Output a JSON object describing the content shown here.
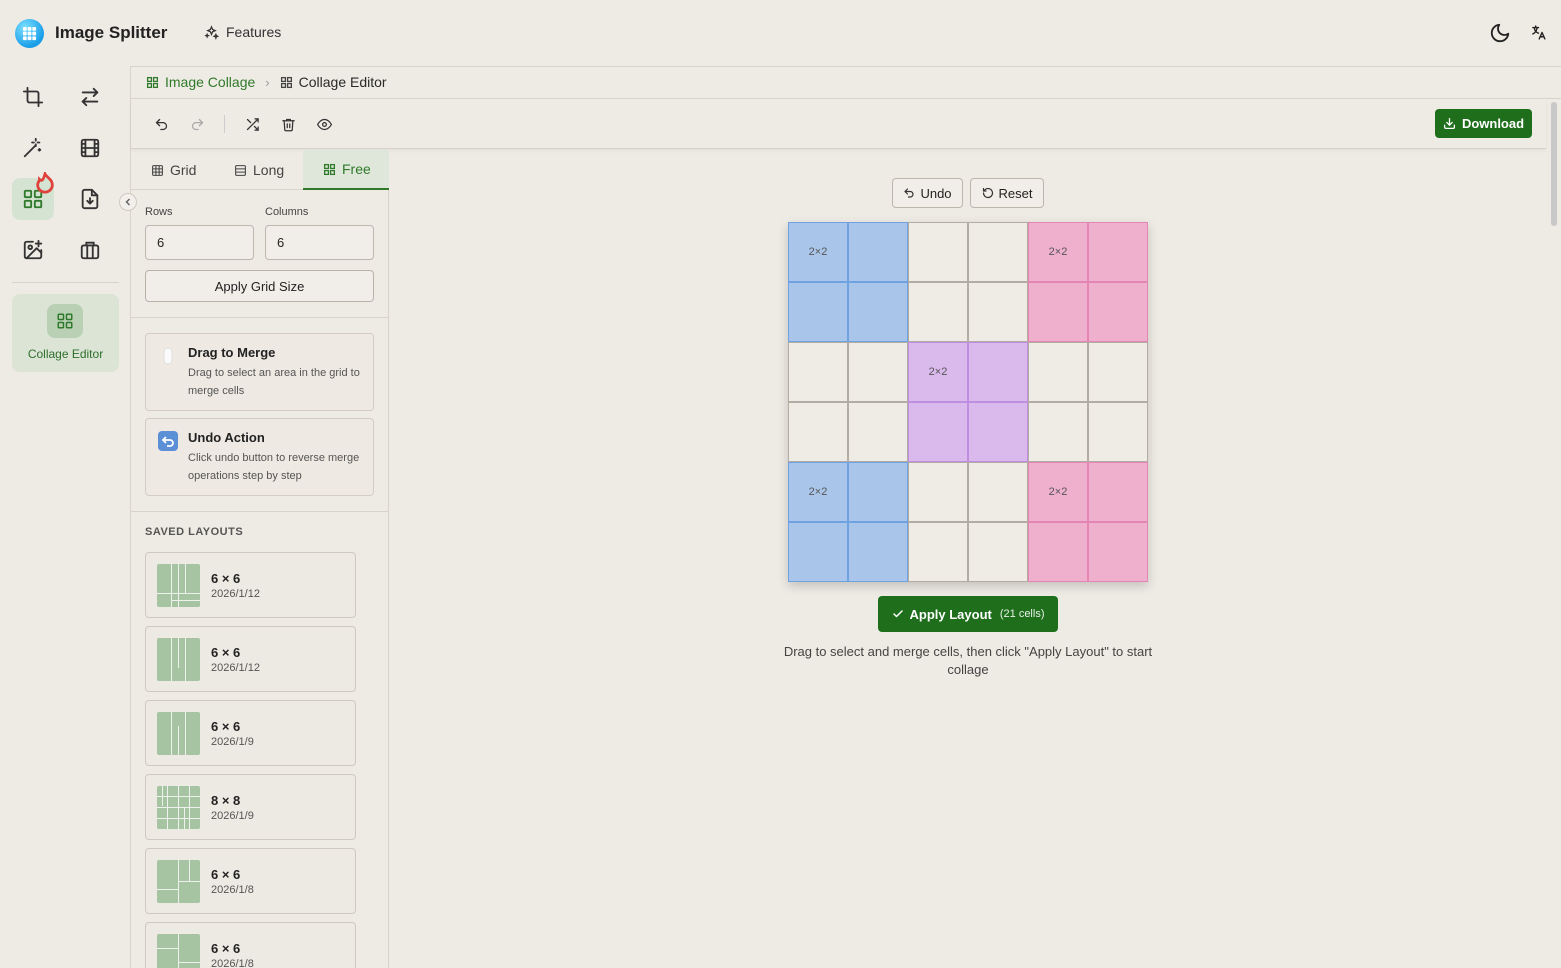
{
  "app": {
    "title": "Image Splitter",
    "features_label": "Features"
  },
  "rail": {
    "active_card_label": "Collage Editor"
  },
  "breadcrumb": {
    "parent": "Image Collage",
    "current": "Collage Editor"
  },
  "toolbar": {
    "download_label": "Download"
  },
  "panel": {
    "tabs": [
      {
        "label": "Grid",
        "icon": "grid-icon"
      },
      {
        "label": "Long",
        "icon": "rows-icon"
      },
      {
        "label": "Free",
        "icon": "layout-icon",
        "active": true
      }
    ],
    "rows_label": "Rows",
    "rows_value": "6",
    "columns_label": "Columns",
    "columns_value": "6",
    "apply_grid_label": "Apply Grid Size",
    "tips": [
      {
        "title": "Drag to Merge",
        "desc": "Drag to select an area in the grid to merge cells"
      },
      {
        "title": "Undo Action",
        "desc": "Click undo button to reverse merge operations step by step"
      }
    ],
    "saved_title": "SAVED LAYOUTS",
    "saved_layouts": [
      {
        "name": "6 × 6",
        "date": "2026/1/12"
      },
      {
        "name": "6 × 6",
        "date": "2026/1/12"
      },
      {
        "name": "6 × 6",
        "date": "2026/1/9"
      },
      {
        "name": "8 × 8",
        "date": "2026/1/9"
      },
      {
        "name": "6 × 6",
        "date": "2026/1/8"
      },
      {
        "name": "6 × 6",
        "date": "2026/1/8"
      }
    ]
  },
  "editor": {
    "undo_label": "Undo",
    "reset_label": "Reset",
    "grid_rows": 6,
    "grid_cols": 6,
    "merged": [
      {
        "row": 0,
        "col": 0,
        "size": "2×2",
        "color": "#a9c6ea",
        "border": "#6fa2e3"
      },
      {
        "row": 0,
        "col": 4,
        "size": "2×2",
        "color": "#eeb0cd",
        "border": "#e585b3"
      },
      {
        "row": 2,
        "col": 2,
        "size": "2×2",
        "color": "#dab9ec",
        "border": "#bf8ee0"
      },
      {
        "row": 4,
        "col": 0,
        "size": "2×2",
        "color": "#a9c6ea",
        "border": "#6fa2e3"
      },
      {
        "row": 4,
        "col": 4,
        "size": "2×2",
        "color": "#eeb0cd",
        "border": "#e585b3"
      }
    ],
    "apply_label": "Apply Layout",
    "cells_count": "(21 cells)",
    "hint": "Drag to select and merge cells, then click \"Apply Layout\" to start collage"
  },
  "colors": {
    "accent": "#1e6e1c",
    "background": "#eeeae4"
  }
}
